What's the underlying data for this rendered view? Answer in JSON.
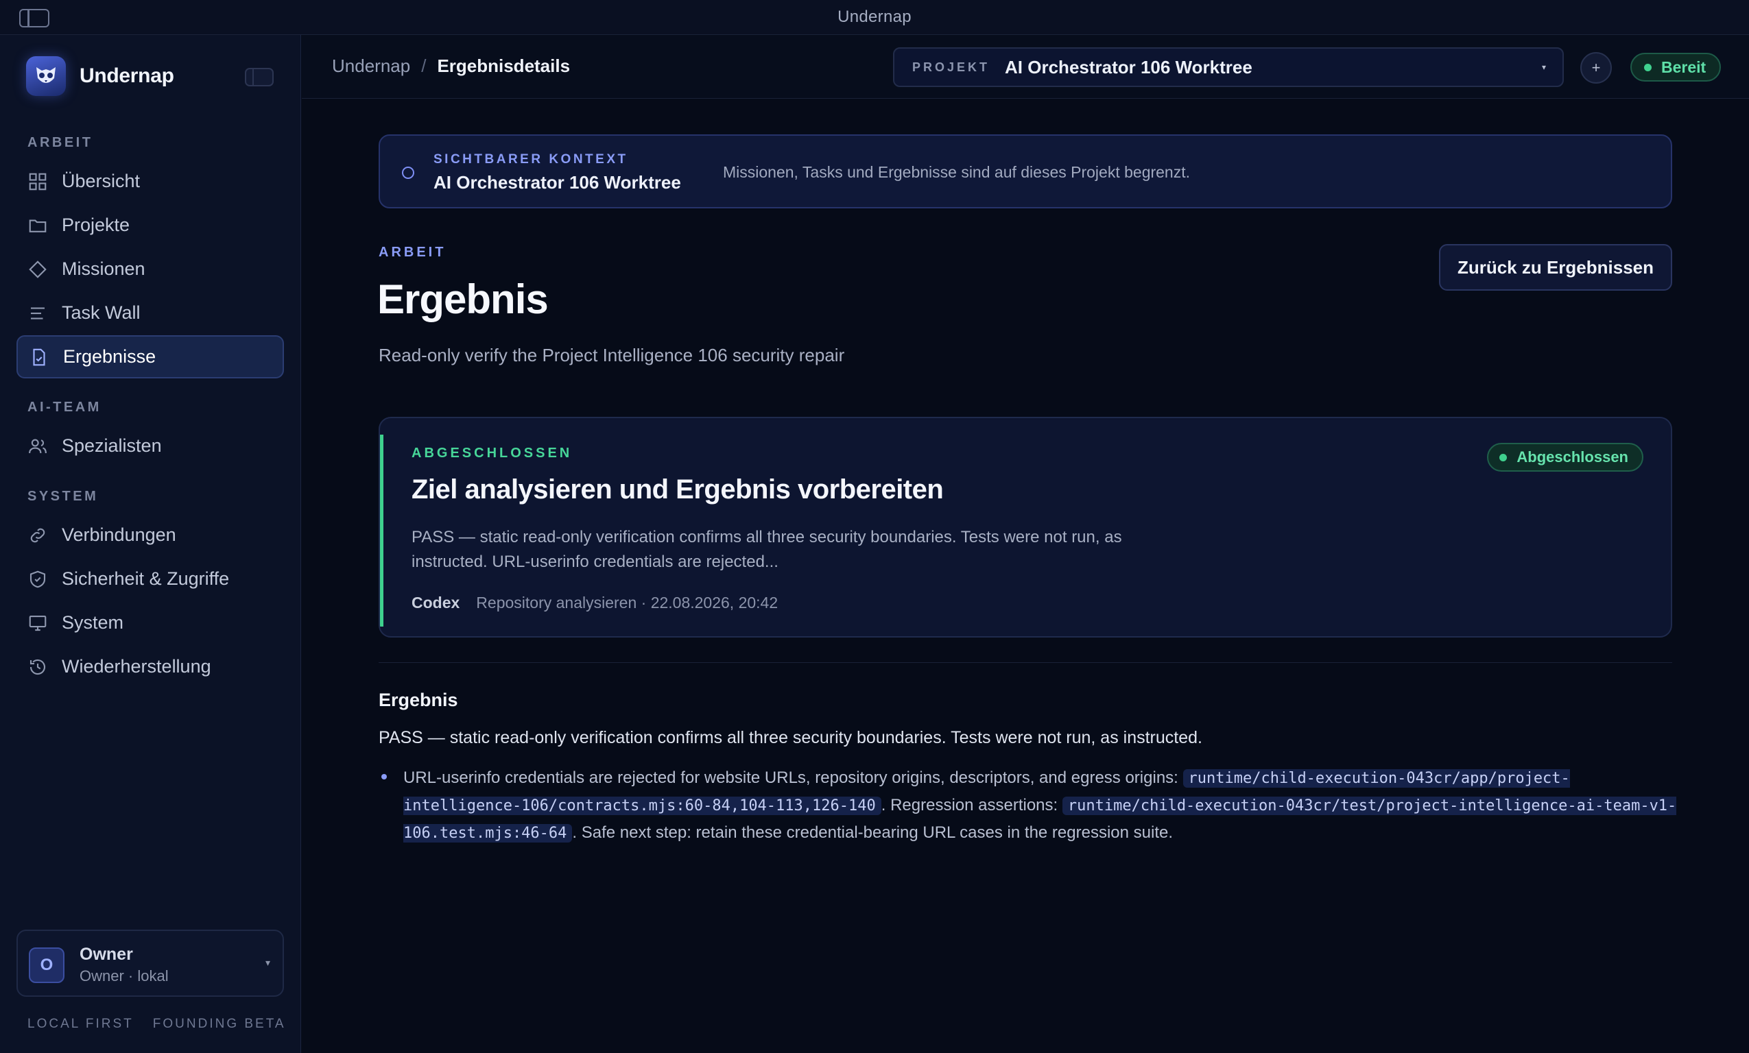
{
  "window": {
    "title": "Undernap"
  },
  "sidebar": {
    "brand": "Undernap",
    "sections": [
      {
        "label": "ARBEIT"
      },
      {
        "label": "AI-TEAM"
      },
      {
        "label": "SYSTEM"
      }
    ],
    "items": [
      {
        "label": "Übersicht",
        "icon": "grid-icon"
      },
      {
        "label": "Projekte",
        "icon": "folder-icon"
      },
      {
        "label": "Missionen",
        "icon": "diamond-icon"
      },
      {
        "label": "Task Wall",
        "icon": "lines-icon"
      },
      {
        "label": "Ergebnisse",
        "icon": "document-check-icon",
        "active": true
      },
      {
        "label": "Spezialisten",
        "icon": "users-icon"
      },
      {
        "label": "Verbindungen",
        "icon": "link-icon"
      },
      {
        "label": "Sicherheit & Zugriffe",
        "icon": "shield-icon"
      },
      {
        "label": "System",
        "icon": "monitor-icon"
      },
      {
        "label": "Wiederherstellung",
        "icon": "history-icon"
      }
    ],
    "user": {
      "initial": "O",
      "name": "Owner",
      "sub": "Owner · lokal"
    },
    "footer": [
      "LOCAL FIRST",
      "FOUNDING BETA"
    ]
  },
  "topbar": {
    "breadcrumb": {
      "root": "Undernap",
      "separator": "/",
      "current": "Ergebnisdetails"
    },
    "project": {
      "label": "PROJEKT",
      "value": "AI Orchestrator 106 Worktree"
    },
    "add_label": "+",
    "status": "Bereit"
  },
  "context": {
    "label": "SICHTBARER KONTEXT",
    "value": "AI Orchestrator 106 Worktree",
    "description": "Missionen, Tasks und Ergebnisse sind auf dieses Projekt begrenzt."
  },
  "page": {
    "eyebrow": "ARBEIT",
    "title": "Ergebnis",
    "subtitle": "Read-only verify the Project Intelligence 106 security repair",
    "back_button": "Zurück zu Ergebnissen"
  },
  "result": {
    "eyebrow": "ABGESCHLOSSEN",
    "title": "Ziel analysieren und Ergebnis vorbereiten",
    "body": "PASS — static read-only verification confirms all three security boundaries. Tests were not run, as instructed. URL-userinfo credentials are rejected...",
    "agent": "Codex",
    "meta": "Repository analysieren · 22.08.2026, 20:42",
    "badge": "Abgeschlossen"
  },
  "detail": {
    "heading": "Ergebnis",
    "summary": "PASS — static read-only verification confirms all three security boundaries. Tests were not run, as instructed.",
    "bullet": {
      "text1": "URL-userinfo credentials are rejected for website URLs, repository origins, descriptors, and egress origins: ",
      "code1": "runtime/child-execution-043cr/app/project-intelligence-106/contracts.mjs:60-84,104-113,126-140",
      "text2": ". Regression assertions: ",
      "code2": "runtime/child-execution-043cr/test/project-intelligence-ai-team-v1-106.test.mjs:46-64",
      "text3": ". Safe next step: retain these credential-bearing URL cases in the regression suite."
    }
  },
  "colors": {
    "background": "#060b18",
    "accent": "#8a9cf7",
    "success": "#3fd18e"
  }
}
